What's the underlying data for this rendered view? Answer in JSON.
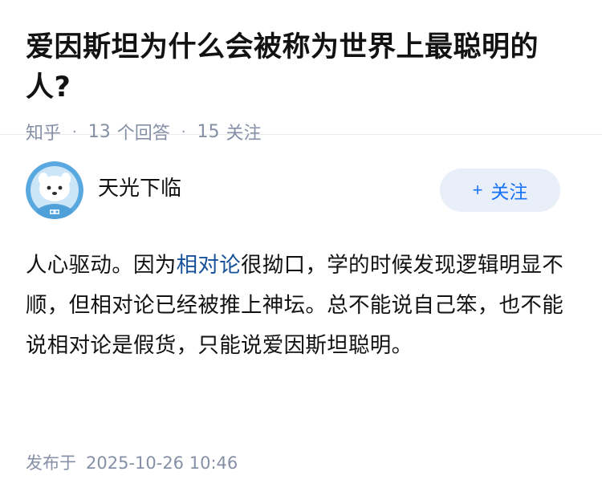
{
  "question": {
    "title": "爱因斯坦为什么会被称为世界上最聪明的人?",
    "source": "知乎",
    "answer_count": "13",
    "answer_label": "个回答",
    "follower_count": "15",
    "follower_label": "关注"
  },
  "answer": {
    "author_name": "天光下临",
    "follow_button_label": "关注",
    "content_before_link": "人心驱动。因为",
    "content_link": "相对论",
    "content_after_link": "很拗口，学的时候发现逻辑明显不顺，但相对论已经被推上神坛。总不能说自己笨，也不能说相对论是假货，只能说爱因斯坦聪明。",
    "published_label": "发布于",
    "published_date": "2025-10-26 10:46"
  },
  "colors": {
    "accent": "#1772f6",
    "link": "#175199",
    "meta_text": "#8590a6",
    "button_bg": "#e8eff9"
  },
  "icons": {
    "avatar": "avatar-cartoon-character"
  }
}
